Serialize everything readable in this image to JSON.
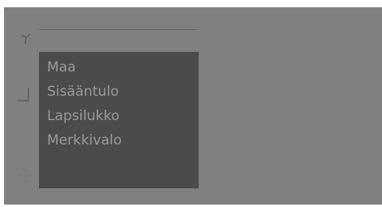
{
  "menu": {
    "items": [
      {
        "label": "Maa"
      },
      {
        "label": "Sisääntulo"
      },
      {
        "label": "Lapsilukko"
      },
      {
        "label": "Merkkivalo"
      }
    ]
  },
  "icons": {
    "top": "antenna-icon",
    "middle": "input-corner-icon",
    "bottom": "move-icon"
  },
  "colors": {
    "background": "#808080",
    "menu_background": "#4b4b4b",
    "menu_text": "#9a9a9a"
  }
}
